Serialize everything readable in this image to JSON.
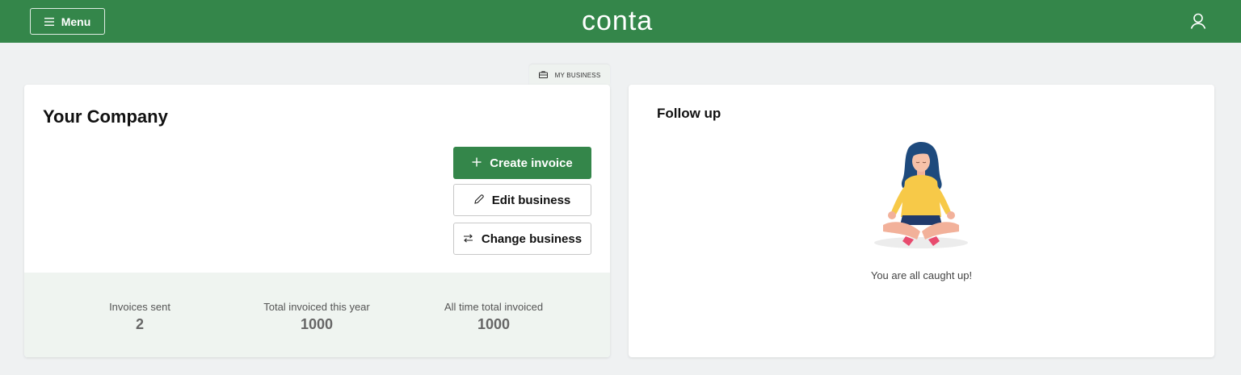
{
  "header": {
    "menu_label": "Menu",
    "logo_text": "conta",
    "colors": {
      "brand": "#34864a"
    },
    "icons": {
      "menu": "hamburger-icon",
      "user": "user-icon"
    }
  },
  "business_tab": {
    "label": "MY BUSINESS",
    "icon": "briefcase-icon"
  },
  "company_card": {
    "title": "Your Company",
    "actions": {
      "create_invoice": "Create invoice",
      "edit_business": "Edit business",
      "change_business": "Change business"
    },
    "stats": [
      {
        "label": "Invoices sent",
        "value": "2"
      },
      {
        "label": "Total invoiced this year",
        "value": "1000"
      },
      {
        "label": "All time total invoiced",
        "value": "1000"
      }
    ]
  },
  "follow_up": {
    "title": "Follow up",
    "message": "You are all caught up!",
    "illustration": "meditating-woman-illustration"
  }
}
